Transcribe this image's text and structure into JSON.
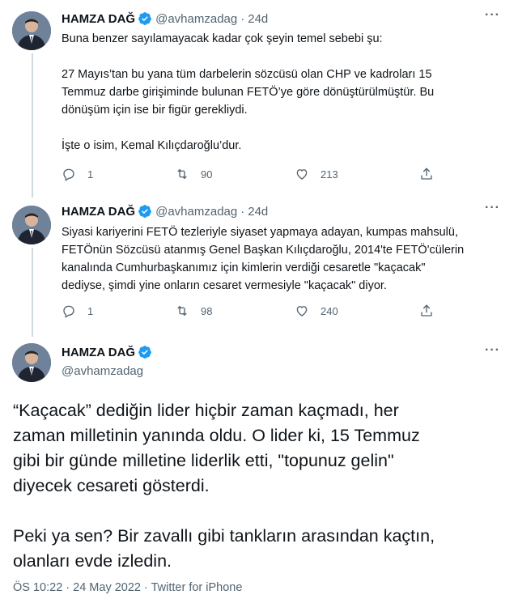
{
  "colors": {
    "verified": "#1d9bf0",
    "secondary": "#536471",
    "text": "#0f1419"
  },
  "tweets": [
    {
      "name": "HAMZA DAĞ",
      "handle": "@avhamzadag",
      "sep": "·",
      "time": "24d",
      "more": "···",
      "lines": [
        "Buna benzer sayılamayacak kadar çok şeyin temel sebebi şu:",
        "",
        "27 Mayıs’tan bu yana tüm darbelerin sözcüsü olan CHP ve kadroları 15",
        "Temmuz darbe girişiminde bulunan FETÖ’ye göre dönüştürülmüştür. Bu",
        "dönüşüm için ise bir figür gerekliydi.",
        "",
        "İşte o isim, Kemal Kılıçdaroğlu’dur."
      ],
      "replies": "1",
      "retweets": "90",
      "likes": "213"
    },
    {
      "name": "HAMZA DAĞ",
      "handle": "@avhamzadag",
      "sep": "·",
      "time": "24d",
      "more": "···",
      "lines": [
        "Siyasi kariyerini FETÖ tezleriyle siyaset yapmaya adayan, kumpas mahsulü,",
        "FETÖnün Sözcüsü atanmış Genel Başkan Kılıçdaroğlu, 2014'te FETÖ'cülerin",
        "kanalında Cumhurbaşkanımız için kimlerin verdiği cesaretle \"kaçacak\"",
        "dediyse, şimdi yine onların cesaret vermesiyle \"kaçacak\" diyor."
      ],
      "replies": "1",
      "retweets": "98",
      "likes": "240"
    }
  ],
  "main_tweet": {
    "name": "HAMZA DAĞ",
    "handle": "@avhamzadag",
    "more": "···",
    "lines": [
      "“Kaçacak” dediğin lider hiçbir zaman kaçmadı, her",
      "zaman milletinin yanında oldu. O lider ki, 15 Temmuz",
      "gibi bir günde milletine liderlik etti, \"topunuz gelin\"",
      "diyecek cesareti gösterdi.",
      "",
      "Peki ya sen? Bir zavallı gibi tankların arasından kaçtın,",
      "olanları evde izledin."
    ],
    "meta": "ÖS 10:22 · 24 May 2022 · Twitter for iPhone"
  }
}
